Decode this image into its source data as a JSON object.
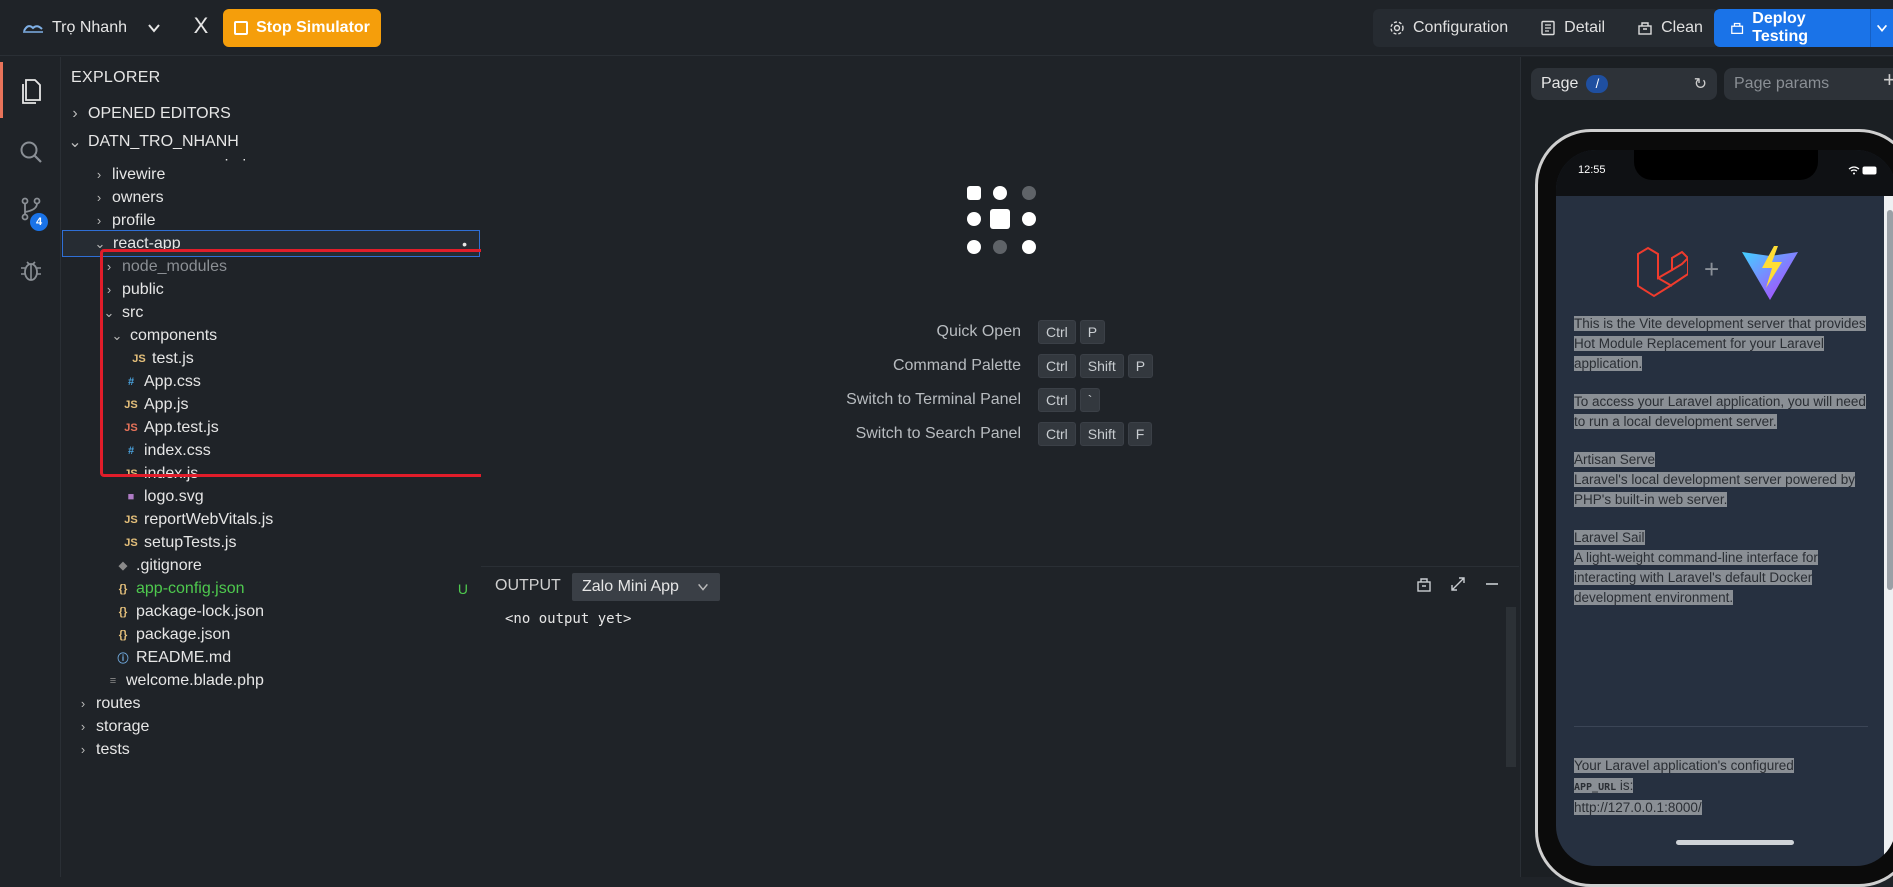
{
  "topbar": {
    "app_name": "Trọ Nhanh",
    "close_label": "X",
    "stop_label": "Stop Simulator",
    "configuration_label": "Configuration",
    "detail_label": "Detail",
    "clean_label": "Clean",
    "deploy_label": "Deploy Testing",
    "accent": "#1a73e8",
    "stop_color": "#f59e0b"
  },
  "activity": {
    "items": [
      "files-icon",
      "search-icon",
      "source-control-icon",
      "debug-icon"
    ],
    "scm_badge": "4"
  },
  "explorer": {
    "title": "EXPLORER",
    "opened_editors": "OPENED EDITORS",
    "project": "DATN_TRO_NHANH",
    "tree": [
      {
        "label": "owner.blade.php",
        "kind": "file"
      },
      {
        "label": "livewire",
        "kind": "folder"
      },
      {
        "label": "owners",
        "kind": "folder"
      },
      {
        "label": "profile",
        "kind": "folder"
      },
      {
        "label": "react-app",
        "kind": "folder-open",
        "marker": "•"
      },
      {
        "label": "node_modules",
        "kind": "folder"
      },
      {
        "label": "public",
        "kind": "folder"
      },
      {
        "label": "src",
        "kind": "folder-open"
      },
      {
        "label": "components",
        "kind": "folder-open"
      },
      {
        "label": "test.js",
        "kind": "js",
        "icon": "JS"
      },
      {
        "label": "App.css",
        "kind": "css",
        "icon": "#"
      },
      {
        "label": "App.js",
        "kind": "js",
        "icon": "JS"
      },
      {
        "label": "App.test.js",
        "kind": "jstest",
        "icon": "JS"
      },
      {
        "label": "index.css",
        "kind": "css",
        "icon": "#"
      },
      {
        "label": "index.js",
        "kind": "js",
        "icon": "JS"
      },
      {
        "label": "logo.svg",
        "kind": "svg"
      },
      {
        "label": "reportWebVitals.js",
        "kind": "js",
        "icon": "JS"
      },
      {
        "label": "setupTests.js",
        "kind": "js",
        "icon": "JS"
      },
      {
        "label": ".gitignore",
        "kind": "git"
      },
      {
        "label": "app-config.json",
        "kind": "json",
        "icon": "{}",
        "status": "U"
      },
      {
        "label": "package-lock.json",
        "kind": "json",
        "icon": "{}"
      },
      {
        "label": "package.json",
        "kind": "json",
        "icon": "{}"
      },
      {
        "label": "README.md",
        "kind": "info",
        "icon": "ⓘ"
      },
      {
        "label": "welcome.blade.php",
        "kind": "file"
      },
      {
        "label": "routes",
        "kind": "folder"
      },
      {
        "label": "storage",
        "kind": "folder"
      },
      {
        "label": "tests",
        "kind": "folder"
      }
    ]
  },
  "editor": {
    "shortcuts": [
      {
        "label": "Quick Open",
        "keys": [
          "Ctrl",
          "P"
        ]
      },
      {
        "label": "Command Palette",
        "keys": [
          "Ctrl",
          "Shift",
          "P"
        ]
      },
      {
        "label": "Switch to Terminal Panel",
        "keys": [
          "Ctrl",
          "`"
        ]
      },
      {
        "label": "Switch to Search Panel",
        "keys": [
          "Ctrl",
          "Shift",
          "F"
        ]
      }
    ]
  },
  "panel": {
    "title": "OUTPUT",
    "channel": "Zalo Mini App",
    "output": "<no output yet>"
  },
  "simulator": {
    "page_label": "Page",
    "page_path": "/",
    "params_placeholder": "Page params",
    "plus_label": "+",
    "clock": "12:55",
    "plus_sign": "+",
    "p1": "This is the Vite development server that provides Hot Module Replacement for your Laravel application.",
    "p2": "To access your Laravel application, you will need to run a local development server.",
    "p3_title": "Artisan Serve",
    "p3_body": "Laravel's local development server powered by PHP's built-in web server.",
    "p4_title": "Laravel Sail",
    "p4_body": "A light-weight command-line interface for interacting with Laravel's default Docker development environment.",
    "p5_a": "Your Laravel application's configured",
    "p5_code": "APP_URL",
    "p5_b": "is:",
    "p5_url": "http://127.0.0.1:8000/"
  }
}
